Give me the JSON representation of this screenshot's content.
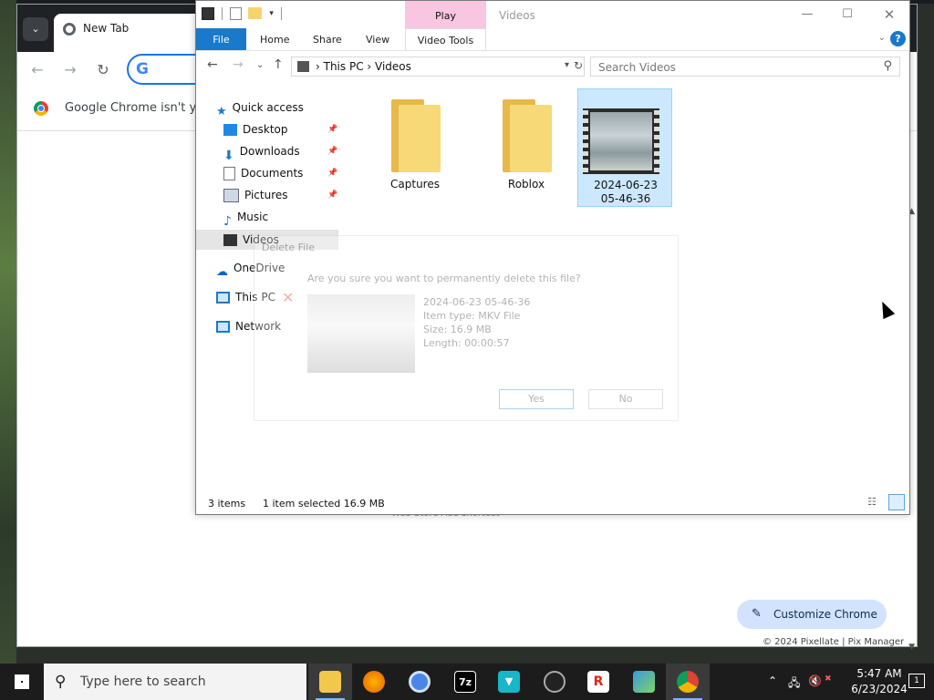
{
  "chrome": {
    "tab_title": "New Tab",
    "infobar_message": "Google Chrome isn't you",
    "customize_label": "Customize Chrome",
    "footer_text": "© 2024 Pixellate | Pix Manager",
    "footer_ghost": "Web Store      Add shortcut"
  },
  "explorer": {
    "play_label": "Play",
    "title": "Videos",
    "tabs": {
      "file": "File",
      "home": "Home",
      "share": "Share",
      "view": "View",
      "video_tools": "Video Tools"
    },
    "address": {
      "root": "This PC",
      "current": "Videos"
    },
    "search_placeholder": "Search Videos",
    "nav": {
      "quick_access": "Quick access",
      "desktop": "Desktop",
      "downloads": "Downloads",
      "documents": "Documents",
      "pictures": "Pictures",
      "music": "Music",
      "videos": "Videos",
      "onedrive": "OneDrive",
      "this_pc": "This PC",
      "network": "Network"
    },
    "items": [
      {
        "name": "Captures",
        "type": "folder"
      },
      {
        "name": "Roblox",
        "type": "folder"
      },
      {
        "name_line1": "2024-06-23",
        "name_line2": "05-46-36",
        "type": "video",
        "selected": true
      }
    ],
    "status": {
      "count": "3 items",
      "selection": "1 item selected  16.9 MB"
    }
  },
  "dialog": {
    "title": "Delete File",
    "question": "Are you sure you want to permanently delete this file?",
    "file_name": "2024-06-23 05-46-36",
    "item_type": "Item type: MKV File",
    "size": "Size: 16.9 MB",
    "length": "Length: 00:00:57",
    "yes": "Yes",
    "no": "No"
  },
  "taskbar": {
    "search_placeholder": "Type here to search",
    "time": "5:47 AM",
    "date": "6/23/2024",
    "notification_count": "1",
    "apps": [
      "file-explorer",
      "firefox",
      "chromium",
      "7zip",
      "vpn",
      "obs",
      "roblox",
      "control-panel",
      "chrome"
    ]
  },
  "colors": {
    "accent": "#1979ca",
    "selection": "#cce8ff",
    "play_context": "#f9c6e1",
    "folder": "#f8d977"
  }
}
